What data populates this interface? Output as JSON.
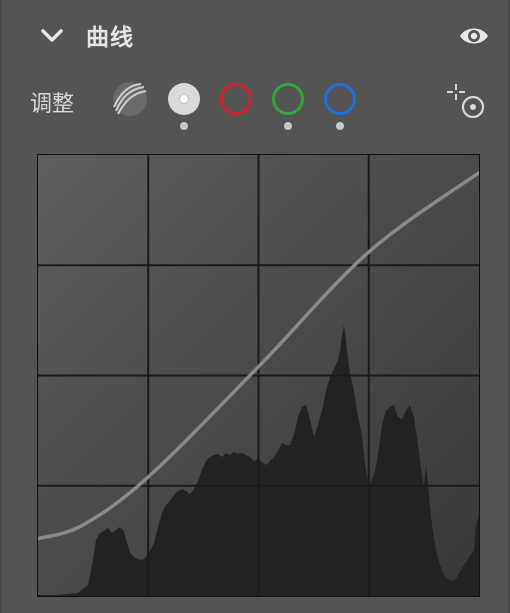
{
  "header": {
    "title": "曲线",
    "collapse_icon": "chevron-down-icon",
    "visibility_icon": "eye-icon"
  },
  "adjust": {
    "label": "调整",
    "channels": [
      {
        "name": "parametric",
        "icon": "parametric-curve-icon",
        "selected": false,
        "has_edits": false
      },
      {
        "name": "rgb",
        "icon": "rgb-channel-icon",
        "color": "#d9d9d9",
        "selected": true,
        "has_edits": true
      },
      {
        "name": "red",
        "icon": "red-channel-icon",
        "color": "#d1232a",
        "selected": false,
        "has_edits": false
      },
      {
        "name": "green",
        "icon": "green-channel-icon",
        "color": "#36a63a",
        "selected": false,
        "has_edits": true
      },
      {
        "name": "blue",
        "icon": "blue-channel-icon",
        "color": "#1f6fe0",
        "selected": false,
        "has_edits": true
      }
    ],
    "picker_icon": "target-adjust-icon"
  },
  "curve": {
    "grid_divisions": 4,
    "curve_color": "#8a8a8a",
    "histogram_color": "#222222",
    "points": [
      [
        0,
        0.13
      ],
      [
        0.1,
        0.16
      ],
      [
        0.25,
        0.27
      ],
      [
        0.5,
        0.52
      ],
      [
        0.75,
        0.78
      ],
      [
        1.0,
        0.96
      ]
    ]
  }
}
